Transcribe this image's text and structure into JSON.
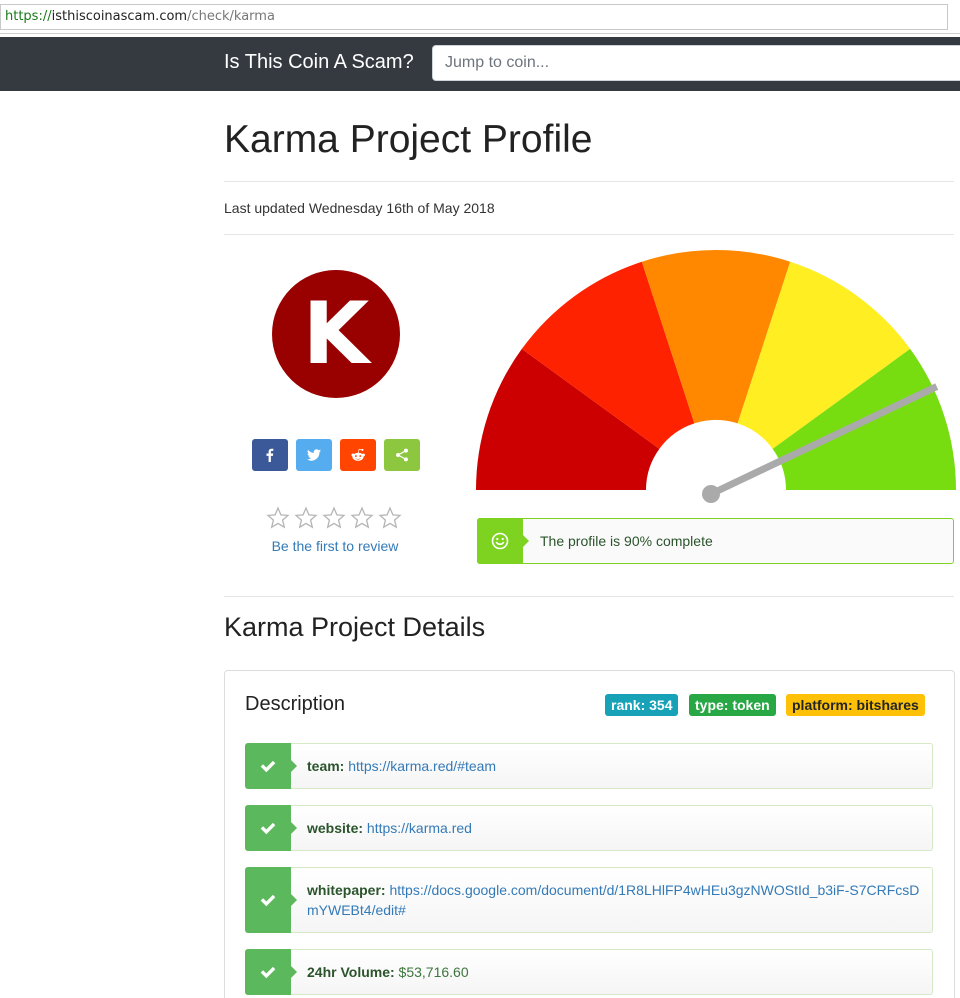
{
  "browser": {
    "url_scheme": "https://",
    "url_host": "isthiscoinascam.com",
    "url_path": "/check/karma"
  },
  "navbar": {
    "brand": "Is This Coin A Scam?",
    "search_placeholder": "Jump to coin..."
  },
  "page": {
    "title": "Karma Project Profile",
    "last_updated": "Last updated Wednesday 16th of May 2018"
  },
  "coin": {
    "logo_letter": "K",
    "logo_color": "#990000"
  },
  "share": [
    {
      "name": "facebook",
      "icon": "facebook-icon",
      "color": "#3b5998"
    },
    {
      "name": "twitter",
      "icon": "twitter-icon",
      "color": "#55acee"
    },
    {
      "name": "reddit",
      "icon": "reddit-icon",
      "color": "#ff4500"
    },
    {
      "name": "share",
      "icon": "share-icon",
      "color": "#8dc63f"
    }
  ],
  "rating": {
    "stars_total": 5,
    "stars_filled": 0,
    "review_link": "Be the first to review"
  },
  "gauge": {
    "segment_colors": [
      "#cc0000",
      "#ff2200",
      "#ff8800",
      "#ffee22",
      "#77dd11"
    ],
    "needle_value_percent": 90,
    "needle_color": "#aaaaaa"
  },
  "profile_status": {
    "icon": "smiley-icon",
    "text": "The profile is 90% complete",
    "color": "#7ed321"
  },
  "details": {
    "title": "Karma Project Details",
    "card_title": "Description",
    "badges": {
      "rank": "rank: 354",
      "type": "type: token",
      "platform": "platform: bitshares"
    },
    "items": [
      {
        "key": "team:",
        "value": "https://karma.red/#team"
      },
      {
        "key": "website:",
        "value": "https://karma.red"
      },
      {
        "key": "whitepaper:",
        "value": "https://docs.google.com/document/d/1R8LHlFP4wHEu3gzNWOStId_b3iF-S7CRFcsDmYWEBt4/edit#"
      },
      {
        "key": "24hr Volume:",
        "value": "$53,716.60"
      }
    ]
  }
}
